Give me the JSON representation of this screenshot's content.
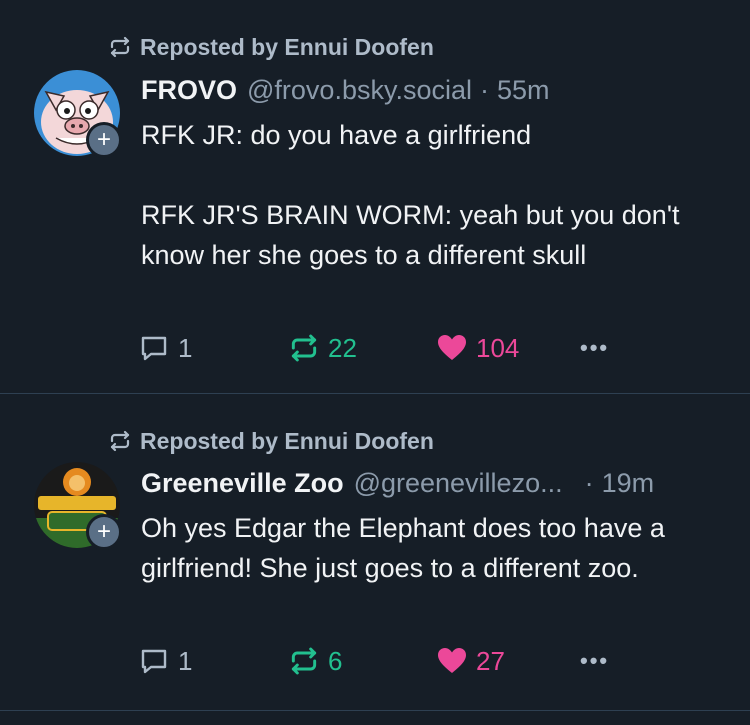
{
  "posts": [
    {
      "repost_label": "Reposted by Ennui Doofen",
      "display_name": "FROVO",
      "handle": "@frovo.bsky.social",
      "separator": "·",
      "time": "55m",
      "text": "RFK JR: do you have a girlfriend\n\nRFK JR'S BRAIN WORM: yeah but you don't know her she goes to a different skull",
      "avatar_icon": "pig-avatar",
      "follow_badge": "+",
      "reply_count": "1",
      "repost_count": "22",
      "like_count": "104",
      "more_label": "•••"
    },
    {
      "repost_label": "Reposted by Ennui Doofen",
      "display_name": "Greeneville Zoo",
      "handle": "@greenevillezo...",
      "separator": "·",
      "time": "19m",
      "text": "Oh yes Edgar the Elephant does too have a girlfriend! She just goes to a different zoo.",
      "avatar_icon": "zoo-logo-avatar",
      "avatar_logo_text": "GREENEVILLE ZOO",
      "follow_badge": "+",
      "reply_count": "1",
      "repost_count": "6",
      "like_count": "27",
      "more_label": "•••"
    }
  ],
  "colors": {
    "background": "#161e27",
    "repost_green": "#22c08f",
    "like_pink": "#ec4899",
    "muted": "#8c9bab"
  }
}
